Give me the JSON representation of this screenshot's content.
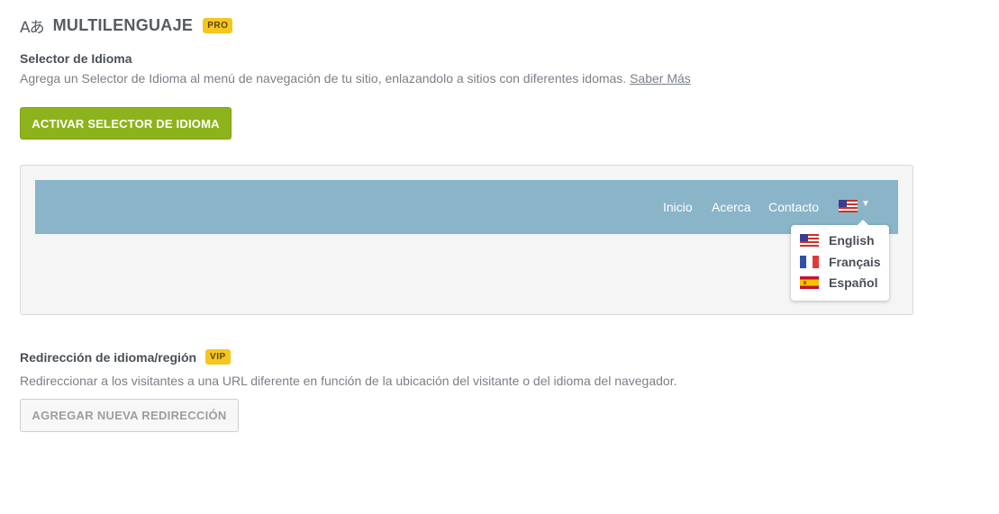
{
  "header": {
    "icon": "translate-icon",
    "icon_glyph": "Aあ",
    "title": "MULTILENGUAJE",
    "badge": "PRO"
  },
  "language_selector": {
    "title": "Selector de Idioma",
    "description": "Agrega un Selector de Idioma al menú de navegación de tu sitio, enlazandolo a sitios con diferentes idomas.",
    "learn_more": "Saber Más",
    "activate_button": "ACTIVAR SELECTOR DE IDIOMA"
  },
  "preview": {
    "nav_links": [
      "Inicio",
      "Acerca",
      "Contacto"
    ],
    "current_flag": "us-flag-icon",
    "languages": [
      {
        "label": "English",
        "flag": "us-flag-icon"
      },
      {
        "label": "Français",
        "flag": "fr-flag-icon"
      },
      {
        "label": "Español",
        "flag": "es-flag-icon"
      }
    ]
  },
  "redirect": {
    "title": "Redirección de idioma/región",
    "badge": "VIP",
    "description": "Redireccionar a los visitantes a una URL diferente en función de la ubicación del visitante o del idioma del navegador.",
    "add_button": "AGREGAR NUEVA REDIRECCIÓN"
  },
  "colors": {
    "accent_green": "#8db31c",
    "badge_yellow": "#f5c61b",
    "navbar_blue": "#8ab4c8"
  }
}
